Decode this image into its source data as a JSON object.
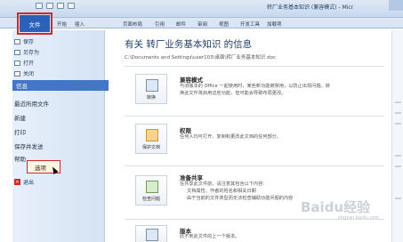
{
  "window": {
    "doc_title": "转厂业务基本知识 (兼容模式) - Micr"
  },
  "ribbon": {
    "file_tab": "文件",
    "tabs": [
      "开始",
      "插入",
      "页面布局",
      "引用",
      "邮件",
      "审阅",
      "视图",
      "开发工具",
      "加载项"
    ]
  },
  "backstage": {
    "commands": [
      "保存",
      "另存为",
      "打开",
      "关闭"
    ],
    "nav": [
      "信息",
      "最近所用文件",
      "新建",
      "打印",
      "保存并发送",
      "帮助"
    ],
    "options_label": "选项",
    "exit_label": "退出"
  },
  "info": {
    "title": "有关 转厂业务基本知识 的信息",
    "path": "C:\\Documents and Settings\\user103\\桌面\\转厂业务基本知识.doc",
    "sections": [
      {
        "button_label": "转换",
        "title": "兼容模式",
        "lines": [
          "与旧版本的 Office 一起使用时，某些新功能被禁用，以防止出现问题。转",
          "换此文件将启用这些功能，但可能会导致布局更改。"
        ]
      },
      {
        "button_label": "保护文档",
        "title": "权限",
        "lines": [
          "任何人均可打开、复制和更改此文档的任何部分。"
        ]
      },
      {
        "button_label": "检查问题",
        "title": "准备共享",
        "lines": [
          "在共享此文件前，请注意其包含以下内容:",
          "文档属性、作者的姓名和相关日期",
          "由于当前的文件类型而无法检查辅助功能问题的内容"
        ]
      },
      {
        "button_label": "",
        "title": "版本",
        "lines": [
          "此不到此文件的上一个版本。"
        ]
      }
    ]
  },
  "watermark": {
    "text": "Baidu经验",
    "sub": "jingyan.baidu.com"
  }
}
